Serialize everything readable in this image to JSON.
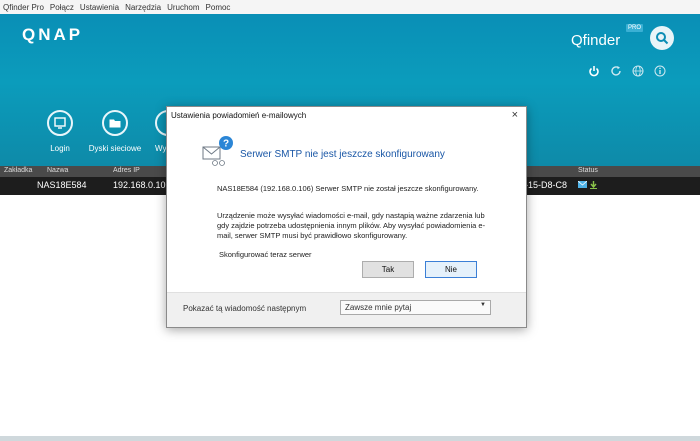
{
  "menu": [
    "Qfinder Pro",
    "Połącz",
    "Ustawienia",
    "Narzędzia",
    "Uruchom",
    "Pomoc"
  ],
  "header": {
    "logo": "QNAP",
    "app_name": "Qfinder",
    "pro_badge": "PRO",
    "tools": [
      {
        "label": "Login",
        "icon": "login-icon"
      },
      {
        "label": "Dyski sieciowe",
        "icon": "folder-icon"
      },
      {
        "label": "Wy",
        "icon": "settings-icon"
      }
    ],
    "right_icons": [
      "power-icon",
      "refresh-icon",
      "globe-icon",
      "info-icon"
    ]
  },
  "table": {
    "headers": [
      "Zakładka",
      "Nazwa",
      "Adres IP",
      "Status"
    ],
    "row": {
      "name": "NAS18E584",
      "ip": "192.168.0.10",
      "mac": "-15-D8-C8"
    }
  },
  "dialog": {
    "title": "Ustawienia powiadomień e-mailowych",
    "close": "×",
    "heading": "Serwer SMTP nie jest jeszcze skonfigurowany",
    "p1": "NAS18E584 (192.168.0.106) Serwer SMTP nie został jeszcze skonfigurowany.",
    "p2": "Urządzenie może wysyłać wiadomości e-mail, gdy nastąpią ważne zdarzenia lub gdy zajdzie potrzeba udostępnienia innym plików. Aby wysyłać powiadomienia e-mail, serwer SMTP musi być prawidłowo skonfigurowany.",
    "link": "Skonfigurować teraz serwer",
    "btn_yes": "Tak",
    "btn_no": "Nie",
    "footer_label": "Pokazać tą wiadomość następnym",
    "footer_select": "Zawsze mnie pytaj"
  },
  "colors": {
    "header_bg": "#0b9cbc",
    "table_row_bg": "#1d1d1d",
    "heading": "#1a57a6"
  }
}
